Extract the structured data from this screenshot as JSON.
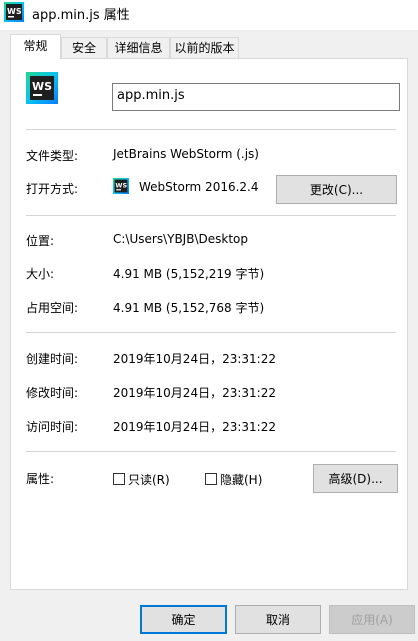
{
  "window": {
    "title": "app.min.js 属性"
  },
  "tabs": [
    {
      "label": "常规"
    },
    {
      "label": "安全"
    },
    {
      "label": "详细信息"
    },
    {
      "label": "以前的版本"
    }
  ],
  "general": {
    "file_name": "app.min.js",
    "type_label": "文件类型:",
    "type_value": "JetBrains WebStorm (.js)",
    "opens_label": "打开方式:",
    "opens_value": "WebStorm 2016.2.4",
    "change_button": "更改(C)...",
    "location_label": "位置:",
    "location_value": "C:\\Users\\YBJB\\Desktop",
    "size_label": "大小:",
    "size_value": "4.91 MB (5,152,219 字节)",
    "disk_label": "占用空间:",
    "disk_value": "4.91 MB (5,152,768 字节)",
    "created_label": "创建时间:",
    "created_value": "2019年10月24日，23:31:22",
    "modified_label": "修改时间:",
    "modified_value": "2019年10月24日，23:31:22",
    "accessed_label": "访问时间:",
    "accessed_value": "2019年10月24日，23:31:22",
    "attributes_label": "属性:",
    "readonly_label": "只读(R)",
    "hidden_label": "隐藏(H)",
    "advanced_button": "高级(D)...",
    "app_icon_text": "WS"
  },
  "footer": {
    "ok": "确定",
    "cancel": "取消",
    "apply": "应用(A)"
  },
  "colors": {
    "accent": "#0078d7",
    "ws_icon_bg": "#1f1f1f",
    "ws_icon_gradient": [
      "#22d88f",
      "#07c3f2",
      "#087cfa"
    ]
  }
}
